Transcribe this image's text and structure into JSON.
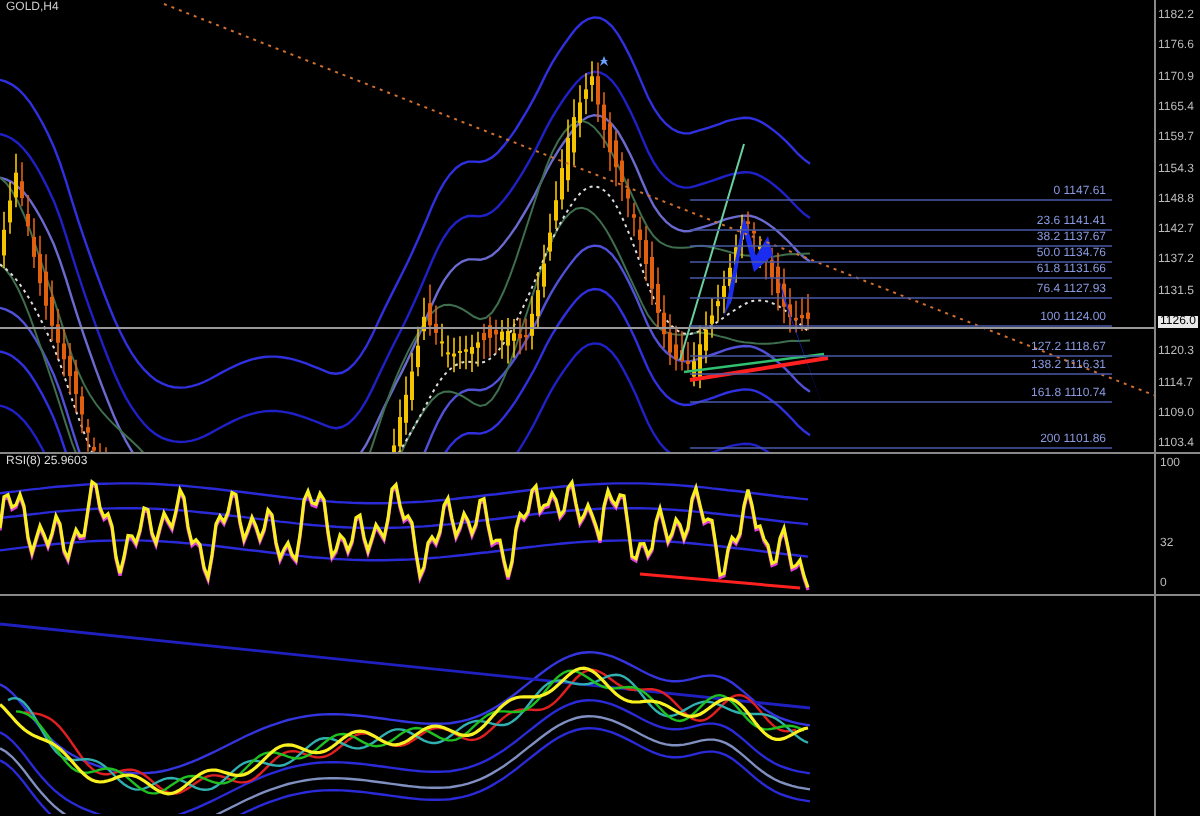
{
  "main_chart": {
    "symbol": "GOLD,H4",
    "price_axis": [
      {
        "label": "1182.2",
        "kind": "tick"
      },
      {
        "label": "1176.6",
        "kind": "tick"
      },
      {
        "label": "1170.9",
        "kind": "tick"
      },
      {
        "label": "1165.4",
        "kind": "tick"
      },
      {
        "label": "1159.7",
        "kind": "tick"
      },
      {
        "label": "1154.3",
        "kind": "tick"
      },
      {
        "label": "1148.8",
        "kind": "tick"
      },
      {
        "label": "1142.7",
        "kind": "tick"
      },
      {
        "label": "1137.2",
        "kind": "tick"
      },
      {
        "label": "1131.5",
        "kind": "tick"
      },
      {
        "label": "1126.0",
        "kind": "current"
      },
      {
        "label": "1120.3",
        "kind": "tick"
      },
      {
        "label": "1114.7",
        "kind": "tick"
      },
      {
        "label": "1109.0",
        "kind": "tick"
      },
      {
        "label": "1103.4",
        "kind": "tick"
      }
    ],
    "fib_levels": [
      {
        "label": "0 1147.61"
      },
      {
        "label": "23.6 1141.41"
      },
      {
        "label": "38.2 1137.67"
      },
      {
        "label": "50.0 1134.76"
      },
      {
        "label": "61.8 1131.66"
      },
      {
        "label": "76.4 1127.93"
      },
      {
        "label": "100 1124.00"
      },
      {
        "label": "127.2 1118.67"
      },
      {
        "label": "138.2 1116.31"
      },
      {
        "label": "161.8 1110.74"
      },
      {
        "label": "200 1101.86"
      }
    ]
  },
  "rsi_pane": {
    "label": "RSI(8) 25.9603",
    "axis": [
      {
        "label": "100"
      },
      {
        "label": "32"
      },
      {
        "label": "0"
      }
    ]
  }
}
